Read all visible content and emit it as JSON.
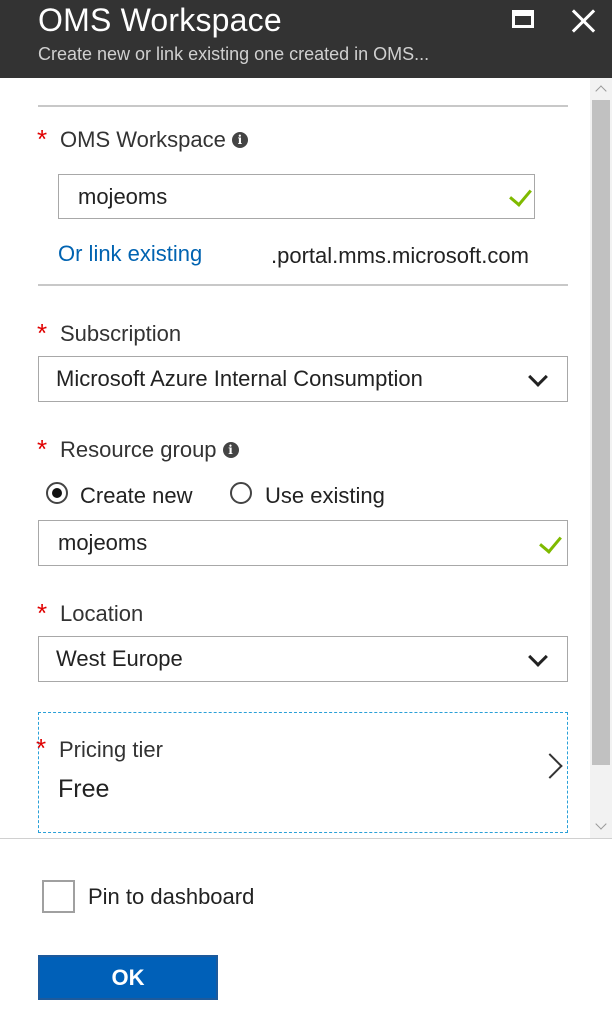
{
  "header": {
    "title": "OMS Workspace",
    "subtitle": "Create new or link existing one created in OMS..."
  },
  "form": {
    "workspace": {
      "label": "OMS Workspace",
      "value": "mojeoms",
      "link_existing": "Or link existing",
      "suffix": ".portal.mms.microsoft.com"
    },
    "subscription": {
      "label": "Subscription",
      "value": "Microsoft Azure Internal Consumption"
    },
    "resource_group": {
      "label": "Resource group",
      "options": [
        "Create new",
        "Use existing"
      ],
      "selected": "Create new",
      "value": "mojeoms"
    },
    "location": {
      "label": "Location",
      "value": "West Europe"
    },
    "pricing_tier": {
      "label": "Pricing tier",
      "value": "Free"
    }
  },
  "footer": {
    "pin_label": "Pin to dashboard",
    "pin_checked": false,
    "ok_label": "OK"
  },
  "icons": {
    "required_marker": "*",
    "info": "i"
  },
  "colors": {
    "header_bg": "#333333",
    "accent_blue": "#0063b1",
    "required_red": "#e00000",
    "valid_green": "#7fba00",
    "focus_dashed": "#2aa0d8"
  }
}
